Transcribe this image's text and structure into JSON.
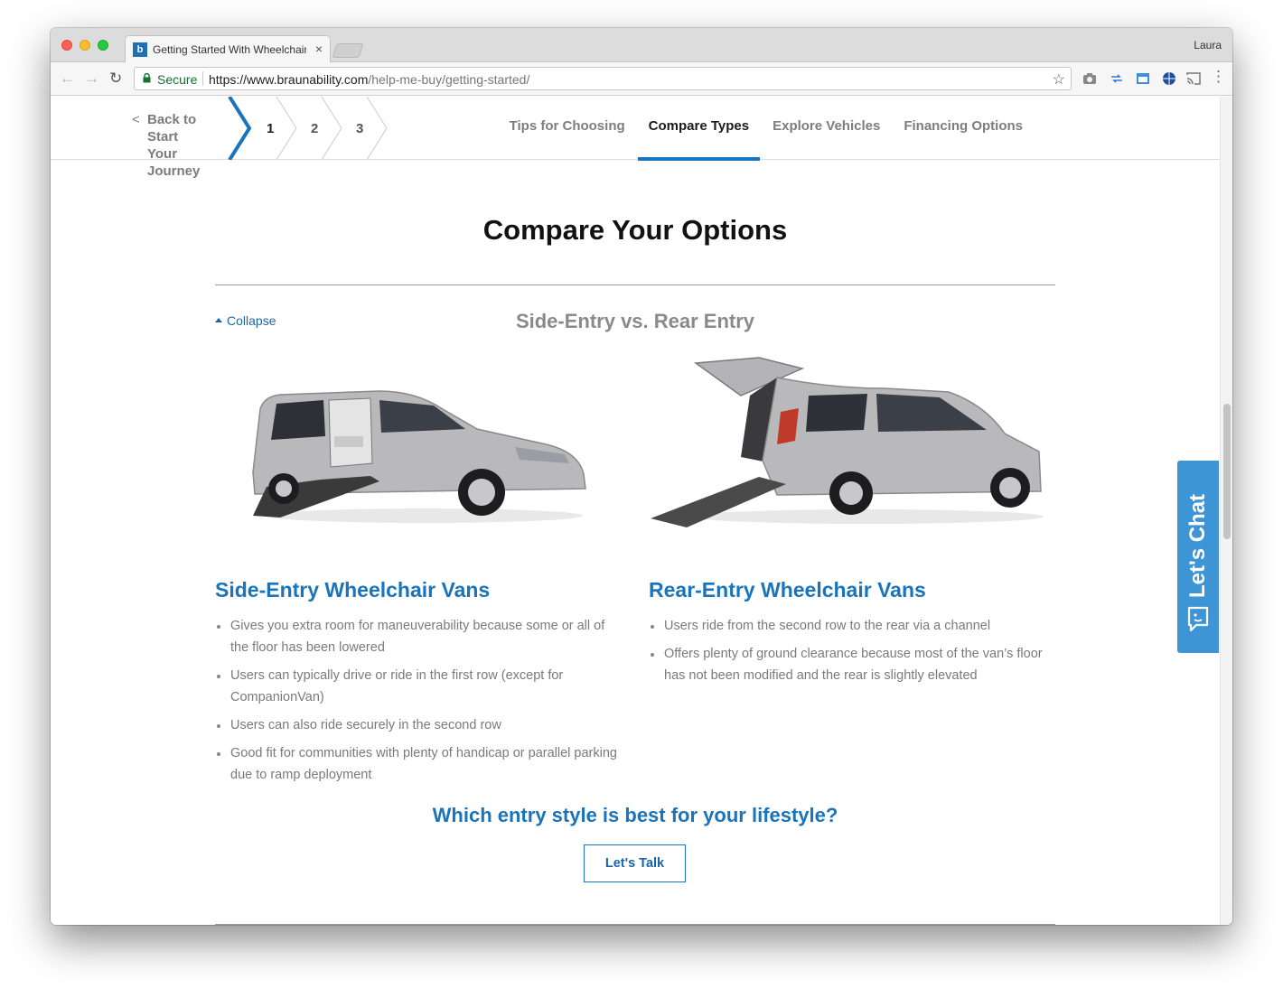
{
  "browser": {
    "tab_title": "Getting Started With Wheelchair",
    "tab_close": "×",
    "profile_name": "Laura",
    "secure_label": "Secure",
    "url_host": "https://www.braunability.com",
    "url_path": "/help-me-buy/getting-started/",
    "star_icon": "☆",
    "favicon_letter": "b"
  },
  "subnav": {
    "back_chevron": "<",
    "back_line1": "Back to Start",
    "back_line2": "Your Journey",
    "steps": [
      "1",
      "2",
      "3"
    ],
    "tabs": [
      {
        "label": "Tips for Choosing",
        "active": false
      },
      {
        "label": "Compare Types",
        "active": true
      },
      {
        "label": "Explore Vehicles",
        "active": false
      },
      {
        "label": "Financing Options",
        "active": false
      }
    ]
  },
  "main": {
    "title": "Compare Your Options",
    "collapse_label": "Collapse",
    "subheading": "Side-Entry vs. Rear Entry",
    "columns": [
      {
        "title": "Side-Entry Wheelchair Vans",
        "image_icon": "side-entry-van-image",
        "bullets": [
          "Gives you extra room for maneuverability because some or all of the floor has been lowered",
          "Users can typically drive or ride in the first row (except for CompanionVan)",
          "Users can also ride securely in the second row",
          "Good fit for communities with plenty of handicap or parallel parking due to ramp deployment"
        ]
      },
      {
        "title": "Rear-Entry Wheelchair Vans",
        "image_icon": "rear-entry-van-image",
        "bullets": [
          "Users ride from the second row to the rear via a channel",
          "Offers plenty of ground clearance because most of the van’s floor has not been modified and the rear is  slightly elevated"
        ]
      }
    ],
    "cta_heading": "Which entry style is best for your lifestyle?",
    "cta_button": "Let's Talk"
  },
  "chat": {
    "label": "Let's Chat",
    "icon": "chat-bubble-icon"
  },
  "colors": {
    "accent_blue": "#1a74bb",
    "chat_blue": "#3e95d6",
    "secure_green": "#137333"
  }
}
